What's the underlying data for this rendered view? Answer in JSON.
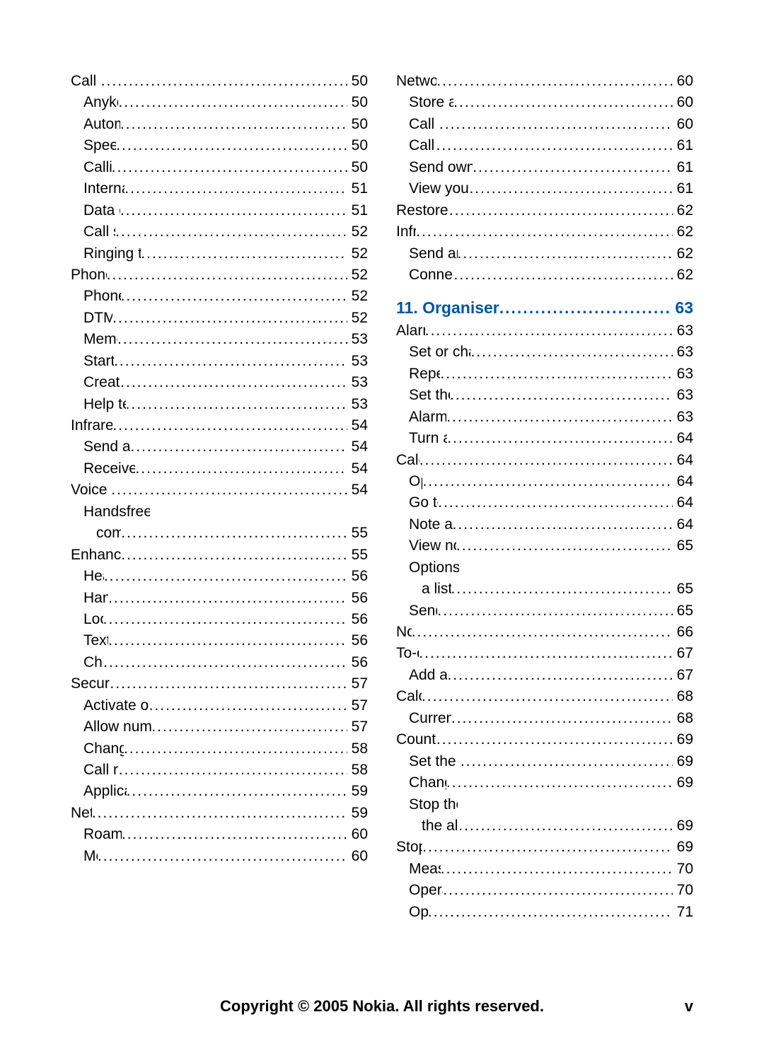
{
  "footer": {
    "copyright": "Copyright © 2005 Nokia. All rights reserved.",
    "roman": "v"
  },
  "chapter11": {
    "label": "11. Organiser",
    "page": "63"
  },
  "left": [
    {
      "indent": 0,
      "label": "Call settings",
      "page": "50"
    },
    {
      "indent": 1,
      "label": "Anykey answer",
      "page": "50"
    },
    {
      "indent": 1,
      "label": "Automatic redial",
      "page": "50"
    },
    {
      "indent": 1,
      "label": "Speed dialling",
      "page": "50"
    },
    {
      "indent": 1,
      "label": "Calling card",
      "page": "50"
    },
    {
      "indent": 1,
      "label": "International prefix",
      "page": "51"
    },
    {
      "indent": 1,
      "label": "Data or fax calls",
      "page": "51"
    },
    {
      "indent": 1,
      "label": "Call summary",
      "page": "52"
    },
    {
      "indent": 1,
      "label": "Ringing tone for no caller ID",
      "page": "52"
    },
    {
      "indent": 0,
      "label": "Phone settings",
      "page": "52"
    },
    {
      "indent": 1,
      "label": "Phone language",
      "page": "52"
    },
    {
      "indent": 1,
      "label": "DTMF tones",
      "page": "52"
    },
    {
      "indent": 1,
      "label": "Memory status",
      "page": "53"
    },
    {
      "indent": 1,
      "label": "Start-up tone",
      "page": "53"
    },
    {
      "indent": 1,
      "label": "Create a banner",
      "page": "53"
    },
    {
      "indent": 1,
      "label": "Help text activation",
      "page": "53"
    },
    {
      "indent": 0,
      "label": "Infrared activation",
      "page": "54"
    },
    {
      "indent": 1,
      "label": "Send a business card",
      "page": "54"
    },
    {
      "indent": 1,
      "label": "Receive a business card",
      "page": "54"
    },
    {
      "indent": 0,
      "label": "Voice commands",
      "page": "54"
    },
    {
      "indent": 1,
      "label": "Handsfree operation with voice",
      "wrap": true
    },
    {
      "indent": 2,
      "label": "commands",
      "page": "55"
    },
    {
      "indent": 0,
      "label": "Enhancement settings",
      "page": "55"
    },
    {
      "indent": 1,
      "label": "Headset",
      "page": "56"
    },
    {
      "indent": 1,
      "label": "Handsfree",
      "page": "56"
    },
    {
      "indent": 1,
      "label": "Loopset",
      "page": "56"
    },
    {
      "indent": 1,
      "label": "Textphone",
      "page": "56"
    },
    {
      "indent": 1,
      "label": "Charger",
      "page": "56"
    },
    {
      "indent": 0,
      "label": "Security settings",
      "page": "57"
    },
    {
      "indent": 1,
      "label": "Activate or deactivate phone lock",
      "page": "57"
    },
    {
      "indent": 1,
      "label": "Allow numbers when phone locked",
      "page": "57"
    },
    {
      "indent": 1,
      "label": "Change lock code",
      "page": "58"
    },
    {
      "indent": 1,
      "label": "Call restrictions",
      "page": "58"
    },
    {
      "indent": 1,
      "label": "Application settings",
      "page": "59"
    },
    {
      "indent": 0,
      "label": "Network",
      "page": "59"
    },
    {
      "indent": 1,
      "label": "Roaming options",
      "page": "60"
    },
    {
      "indent": 1,
      "label": "Mode",
      "page": "60"
    }
  ],
  "right_a": [
    {
      "indent": 0,
      "label": "Network services",
      "page": "60"
    },
    {
      "indent": 1,
      "label": "Store a feature code",
      "page": "60"
    },
    {
      "indent": 1,
      "label": "Call diverting",
      "page": "60"
    },
    {
      "indent": 1,
      "label": "Call waiting",
      "page": "61"
    },
    {
      "indent": 1,
      "label": "Send own caller ID when calling",
      "page": "61"
    },
    {
      "indent": 1,
      "label": "View your own phone number",
      "page": "61"
    },
    {
      "indent": 0,
      "label": "Restore factory settings",
      "page": "62"
    },
    {
      "indent": 0,
      "label": "Infrared",
      "page": "62"
    },
    {
      "indent": 1,
      "label": "Send and receive data",
      "page": "62"
    },
    {
      "indent": 1,
      "label": "Connection indicator",
      "page": "62"
    }
  ],
  "right_b": [
    {
      "indent": 0,
      "label": "Alarm clock",
      "page": "63"
    },
    {
      "indent": 1,
      "label": "Set or change an alarm setting",
      "page": "63"
    },
    {
      "indent": 1,
      "label": "Repeat alarm",
      "page": "63"
    },
    {
      "indent": 1,
      "label": "Set the alarm tone",
      "page": "63"
    },
    {
      "indent": 1,
      "label": "Alarm conditions",
      "page": "63"
    },
    {
      "indent": 1,
      "label": "Turn an alarm off",
      "page": "64"
    },
    {
      "indent": 0,
      "label": "Calendar",
      "page": "64"
    },
    {
      "indent": 1,
      "label": "Open",
      "page": "64"
    },
    {
      "indent": 1,
      "label": "Go to a date",
      "page": "64"
    },
    {
      "indent": 1,
      "label": "Note a specific date",
      "page": "64"
    },
    {
      "indent": 1,
      "label": "View notes (day view)",
      "page": "65"
    },
    {
      "indent": 1,
      "label": "Options while viewing",
      "wrap": true
    },
    {
      "indent": 2,
      "label": "a list of notes",
      "page": "65"
    },
    {
      "indent": 1,
      "label": "Send a note",
      "page": "65"
    },
    {
      "indent": 0,
      "label": "Notes",
      "page": "66"
    },
    {
      "indent": 0,
      "label": "To-do list",
      "page": "67"
    },
    {
      "indent": 1,
      "label": "Add a To-do note",
      "page": "67"
    },
    {
      "indent": 0,
      "label": "Calculator",
      "page": "68"
    },
    {
      "indent": 1,
      "label": "Currency converter",
      "page": "68"
    },
    {
      "indent": 0,
      "label": "Countdown timer",
      "page": "69"
    },
    {
      "indent": 1,
      "label": "Set the countdown timer",
      "page": "69"
    },
    {
      "indent": 1,
      "label": "Change the time",
      "page": "69"
    },
    {
      "indent": 1,
      "label": "Stop the timer before",
      "wrap": true
    },
    {
      "indent": 2,
      "label": "the alarm sounds",
      "page": "69"
    },
    {
      "indent": 0,
      "label": "Stopwatch",
      "page": "69"
    },
    {
      "indent": 1,
      "label": "Measure time",
      "page": "70"
    },
    {
      "indent": 1,
      "label": "Operation note",
      "page": "70"
    },
    {
      "indent": 1,
      "label": "Options",
      "page": "71"
    }
  ]
}
